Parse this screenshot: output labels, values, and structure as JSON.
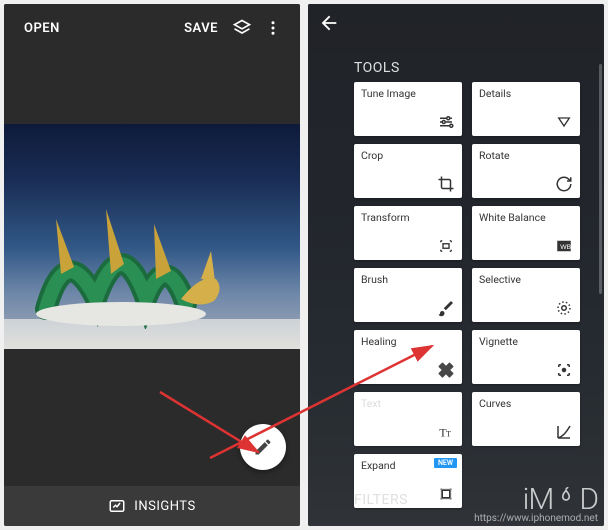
{
  "left": {
    "open": "OPEN",
    "save": "SAVE",
    "insights": "INSIGHTS"
  },
  "right": {
    "tools_label": "TOOLS",
    "filters_label": "FILTERS",
    "new_badge": "NEW",
    "tools": [
      {
        "label": "Tune Image"
      },
      {
        "label": "Details"
      },
      {
        "label": "Crop"
      },
      {
        "label": "Rotate"
      },
      {
        "label": "Transform"
      },
      {
        "label": "White Balance"
      },
      {
        "label": "Brush"
      },
      {
        "label": "Selective"
      },
      {
        "label": "Healing"
      },
      {
        "label": "Vignette"
      },
      {
        "label": "Text"
      },
      {
        "label": "Curves"
      },
      {
        "label": "Expand"
      }
    ]
  },
  "watermark": {
    "logo": "iM   D",
    "url": "https://www.iphonemod.net"
  }
}
